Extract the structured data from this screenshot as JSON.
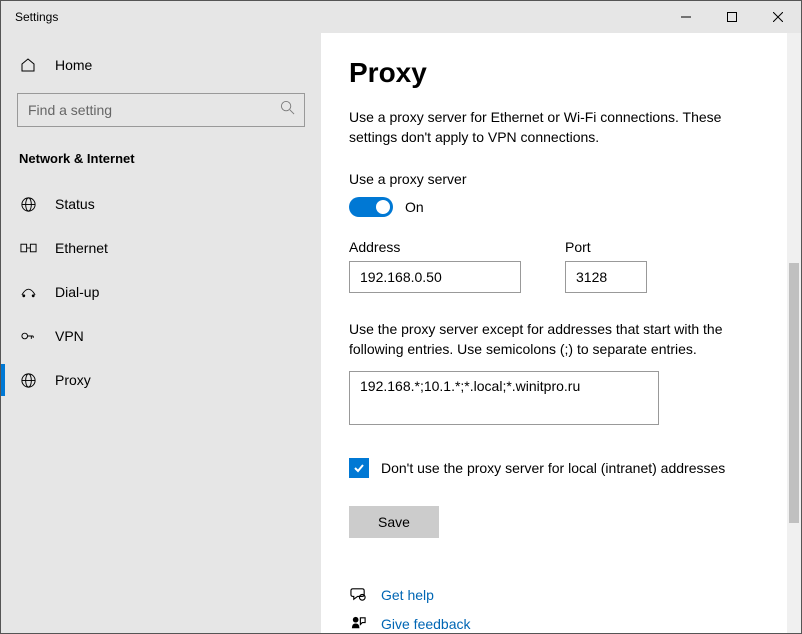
{
  "window": {
    "title": "Settings"
  },
  "sidebar": {
    "home": "Home",
    "search_placeholder": "Find a setting",
    "category": "Network & Internet",
    "items": [
      {
        "label": "Status"
      },
      {
        "label": "Ethernet"
      },
      {
        "label": "Dial-up"
      },
      {
        "label": "VPN"
      },
      {
        "label": "Proxy"
      }
    ]
  },
  "page": {
    "title": "Proxy",
    "description": "Use a proxy server for Ethernet or Wi-Fi connections. These settings don't apply to VPN connections.",
    "use_proxy_label": "Use a proxy server",
    "toggle_state": "On",
    "address_label": "Address",
    "address_value": "192.168.0.50",
    "port_label": "Port",
    "port_value": "3128",
    "exceptions_text": "Use the proxy server except for addresses that start with the following entries. Use semicolons (;) to separate entries.",
    "exceptions_value": "192.168.*;10.1.*;*.local;*.winitpro.ru",
    "local_bypass_label": "Don't use the proxy server for local (intranet) addresses",
    "save_label": "Save",
    "help_link": "Get help",
    "feedback_link": "Give feedback"
  }
}
